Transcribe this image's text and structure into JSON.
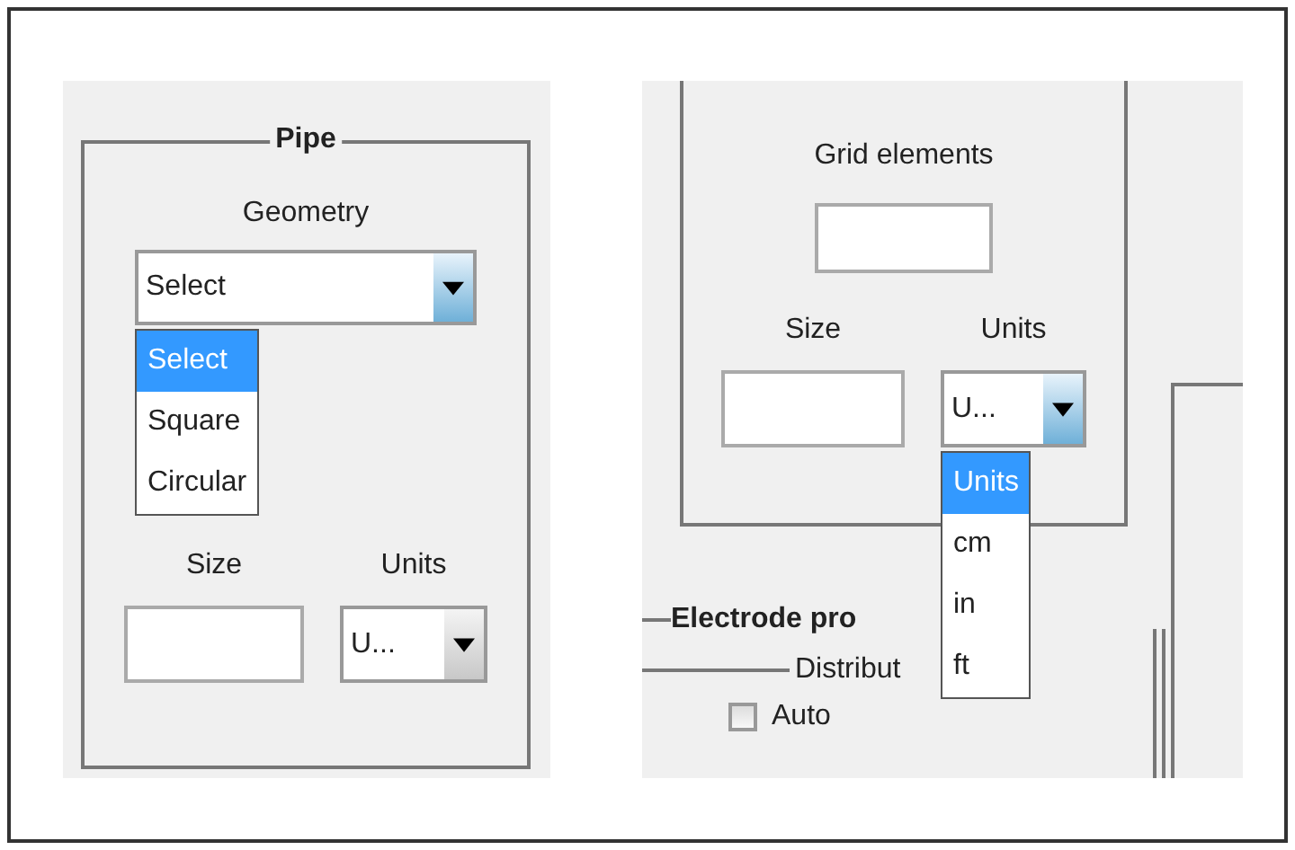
{
  "pipe": {
    "title": "Pipe",
    "geometry_label": "Geometry",
    "geometry": {
      "value": "Select",
      "expanded": true,
      "options": [
        {
          "label": "Select",
          "selected": true
        },
        {
          "label": "Square",
          "selected": false
        },
        {
          "label": "Circular",
          "selected": false
        }
      ]
    },
    "size_label": "Size",
    "units_label": "Units",
    "units": {
      "value": "U...",
      "expanded": false
    }
  },
  "grid": {
    "label": "Grid elements",
    "size_label": "Size",
    "units_label": "Units",
    "units": {
      "value": "U...",
      "expanded": true,
      "options": [
        {
          "label": "Units",
          "selected": true
        },
        {
          "label": "cm",
          "selected": false
        },
        {
          "label": "in",
          "selected": false
        },
        {
          "label": "ft",
          "selected": false
        }
      ]
    }
  },
  "electrode": {
    "title": "Electrode pro",
    "distribution": {
      "title": "Distribut",
      "auto": {
        "label": "Auto",
        "checked": false
      }
    }
  }
}
